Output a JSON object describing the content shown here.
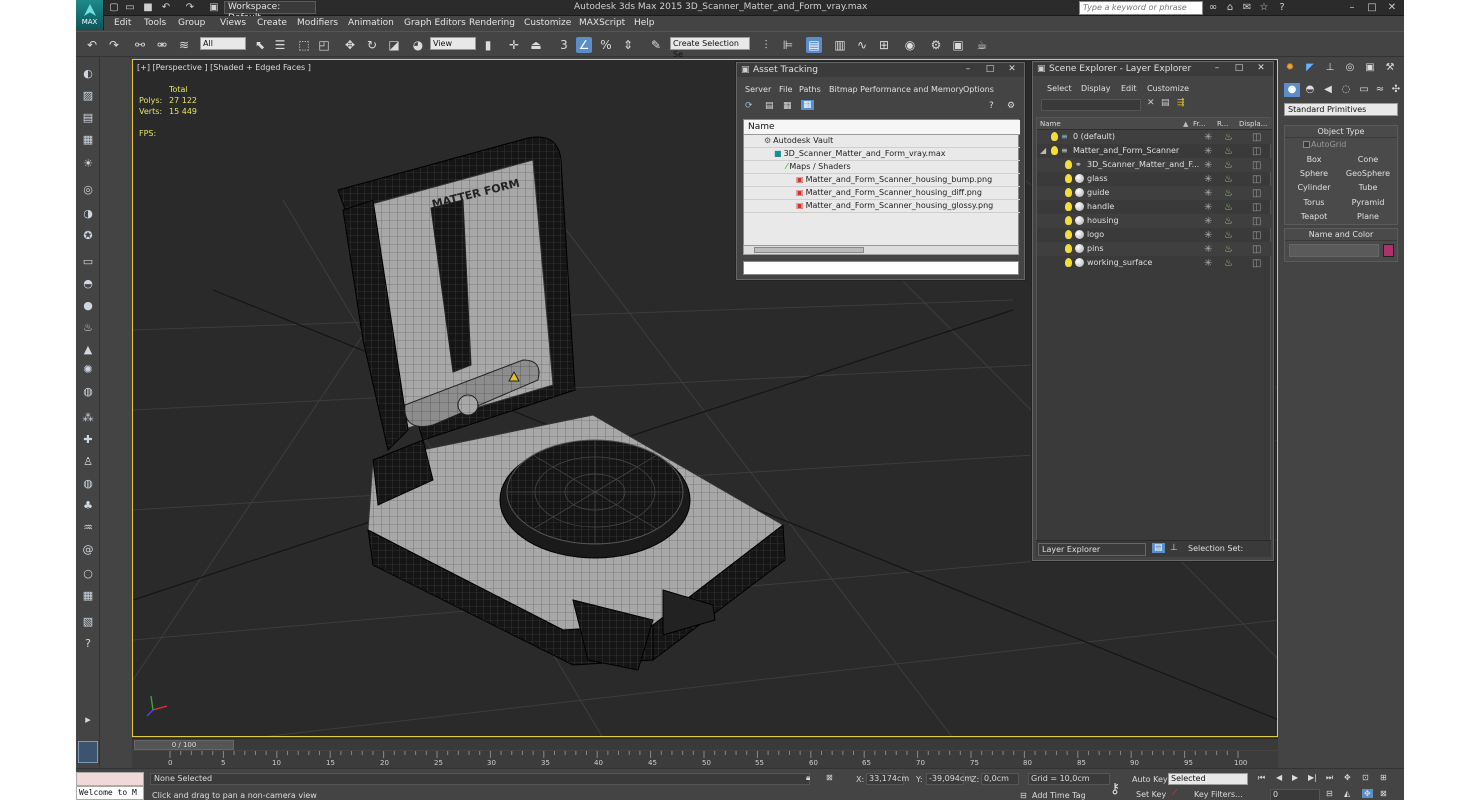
{
  "title_bar": {
    "app_title": "Autodesk 3ds Max  2015    3D_Scanner_Matter_and_Form_vray.max",
    "logo_text": "MAX",
    "workspace": "Workspace: Default",
    "search_placeholder": "Type a keyword or phrase"
  },
  "menu": [
    "Edit",
    "Tools",
    "Group",
    "Views",
    "Create",
    "Modifiers",
    "Animation",
    "Graph Editors",
    "Rendering",
    "Customize",
    "MAXScript",
    "Help"
  ],
  "toolbar": {
    "selection_filter": "All",
    "ref_coord": "View",
    "named_selection": "Create Selection Se"
  },
  "viewport": {
    "label": "[+] [Perspective ] [Shaded + Edged Faces ]",
    "stats": {
      "total_label": "Total",
      "polys_label": "Polys:",
      "polys": "27 122",
      "verts_label": "Verts:",
      "verts": "15 449",
      "fps_label": "FPS:"
    },
    "model_logo_text": "MATTER FORM"
  },
  "asset_tracking": {
    "title": "Asset Tracking",
    "menu": [
      "Server",
      "File",
      "Paths",
      "Bitmap Performance and Memory",
      "Options"
    ],
    "column": "Name",
    "rows": [
      "Autodesk Vault",
      "3D_Scanner_Matter_and_Form_vray.max",
      "Maps / Shaders",
      "Matter_and_Form_Scanner_housing_bump.png",
      "Matter_and_Form_Scanner_housing_diff.png",
      "Matter_and_Form_Scanner_housing_glossy.png"
    ]
  },
  "scene_explorer": {
    "title": "Scene Explorer - Layer Explorer",
    "menu": [
      "Select",
      "Display",
      "Edit",
      "Customize"
    ],
    "columns": [
      "Name",
      "Fr...",
      "R...",
      "Displa..."
    ],
    "rows": [
      "0 (default)",
      "Matter_and_Form_Scanner",
      "3D_Scanner_Matter_and_F...",
      "glass",
      "guide",
      "handle",
      "housing",
      "logo",
      "pins",
      "working_surface"
    ],
    "footer_mode": "Layer Explorer",
    "selection_set_label": "Selection Set:"
  },
  "command_panel": {
    "category": "Standard Primitives",
    "object_type_title": "Object Type",
    "autogrid": "AutoGrid",
    "buttons": [
      "Box",
      "Cone",
      "Sphere",
      "GeoSphere",
      "Cylinder",
      "Tube",
      "Torus",
      "Pyramid",
      "Teapot",
      "Plane"
    ],
    "name_color_title": "Name and Color",
    "color": "#b0306b"
  },
  "timeline": {
    "slider": "0 / 100",
    "ticks": [
      "0",
      "5",
      "10",
      "15",
      "20",
      "25",
      "30",
      "35",
      "40",
      "45",
      "50",
      "55",
      "60",
      "65",
      "70",
      "75",
      "80",
      "85",
      "90",
      "95",
      "100"
    ]
  },
  "status": {
    "listener": "Welcome to M",
    "selection": "None Selected",
    "prompt": "Click and drag to pan a non-camera view",
    "x_label": "X:",
    "x": "33,174cm",
    "y_label": "Y:",
    "y": "-39,094cm",
    "z_label": "Z:",
    "z": "0,0cm",
    "grid": "Grid = 10,0cm",
    "add_time_tag": "Add Time Tag",
    "auto_key": "Auto Key",
    "set_key": "Set Key",
    "key_mode": "Selected",
    "key_filters": "Key Filters...",
    "frame": "0"
  }
}
